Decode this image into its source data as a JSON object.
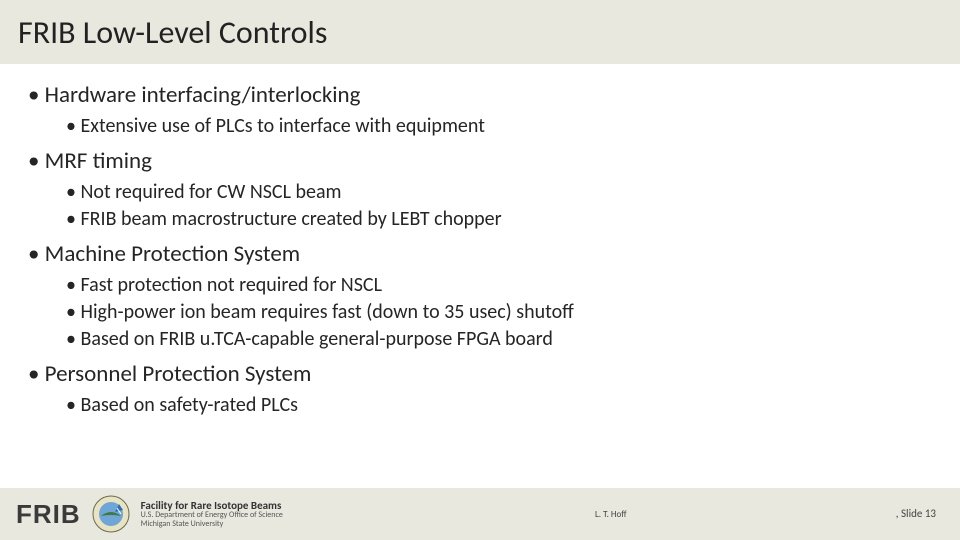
{
  "title": "FRIB Low-Level Controls",
  "bullets": [
    {
      "text": "Hardware interfacing/interlocking",
      "sub": [
        "Extensive use of PLCs to interface with equipment"
      ]
    },
    {
      "text": "MRF timing",
      "sub": [
        "Not required for CW NSCL beam",
        "FRIB beam macrostructure created by LEBT chopper"
      ]
    },
    {
      "text": "Machine Protection System",
      "sub": [
        "Fast protection not required for NSCL",
        "High-power ion beam requires fast (down to 35 usec) shutoff",
        "Based on FRIB u.TCA-capable general-purpose FPGA board"
      ]
    },
    {
      "text": "Personnel Protection System",
      "sub": [
        "Based on safety-rated PLCs"
      ]
    }
  ],
  "footer": {
    "brand": "FRIB",
    "facility_line1": "Facility for Rare Isotope Beams",
    "facility_line2": "U.S. Department of Energy Office of Science",
    "facility_line3": "Michigan State University",
    "author": "L. T. Hoff",
    "slide_label": ", Slide 13"
  }
}
